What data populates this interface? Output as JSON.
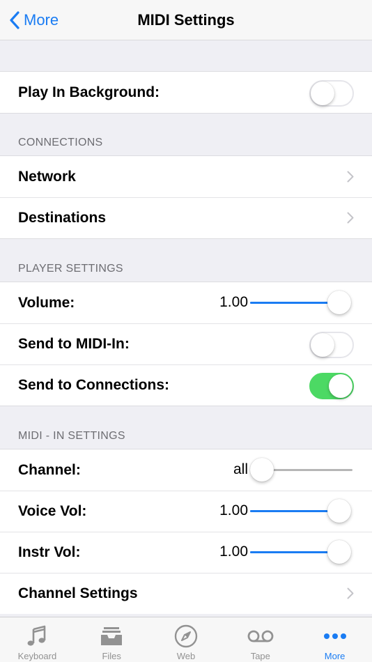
{
  "navbar": {
    "back_label": "More",
    "title": "MIDI Settings"
  },
  "general": {
    "play_in_background": {
      "label": "Play In Background:",
      "on": false
    }
  },
  "connections": {
    "header": "CONNECTIONS",
    "network_label": "Network",
    "destinations_label": "Destinations"
  },
  "player_settings": {
    "header": "PLAYER SETTINGS",
    "volume": {
      "label": "Volume:",
      "value_text": "1.00",
      "fraction": 1.0
    },
    "send_to_midi_in": {
      "label": "Send to MIDI-In:",
      "on": false
    },
    "send_to_connections": {
      "label": "Send to Connections:",
      "on": true
    }
  },
  "midi_in_settings": {
    "header": "MIDI - IN SETTINGS",
    "channel": {
      "label": "Channel:",
      "value_text": "all",
      "fraction": 0.0
    },
    "voice_vol": {
      "label": "Voice Vol:",
      "value_text": "1.00",
      "fraction": 1.0
    },
    "instr_vol": {
      "label": "Instr Vol:",
      "value_text": "1.00",
      "fraction": 1.0
    },
    "channel_settings_label": "Channel Settings"
  },
  "tabbar": {
    "active": "more",
    "tabs": [
      {
        "id": "keyboard",
        "label": "Keyboard",
        "icon": "music-note-icon"
      },
      {
        "id": "files",
        "label": "Files",
        "icon": "tray-icon"
      },
      {
        "id": "web",
        "label": "Web",
        "icon": "compass-icon"
      },
      {
        "id": "tape",
        "label": "Tape",
        "icon": "voicemail-tape-icon"
      },
      {
        "id": "more",
        "label": "More",
        "icon": "more-dots-icon"
      }
    ]
  },
  "colors": {
    "accent": "#1a7cf3",
    "toggle_on": "#4cd964",
    "background": "#efeff4",
    "secondary_text": "#6d6d72"
  }
}
